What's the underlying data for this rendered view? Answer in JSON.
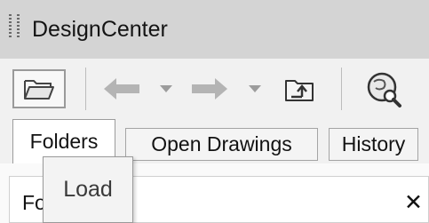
{
  "window": {
    "title": "DesignCenter"
  },
  "toolbar": {
    "buttons": [
      {
        "name": "load",
        "icon": "folder-open-icon"
      },
      {
        "name": "back",
        "icon": "arrow-left-icon"
      },
      {
        "name": "back-dropdown",
        "icon": "chevron-down-icon"
      },
      {
        "name": "forward",
        "icon": "arrow-right-icon"
      },
      {
        "name": "forward-dropdown",
        "icon": "chevron-down-icon"
      },
      {
        "name": "up",
        "icon": "folder-up-icon"
      },
      {
        "name": "search",
        "icon": "search-icon"
      }
    ]
  },
  "tabs": [
    {
      "label": "Folders",
      "active": true
    },
    {
      "label": "Open Drawings",
      "active": false
    },
    {
      "label": "History",
      "active": false
    }
  ],
  "pane": {
    "header_label": "Fo",
    "close_glyph": "✕"
  },
  "tooltip": {
    "text": "Load"
  }
}
